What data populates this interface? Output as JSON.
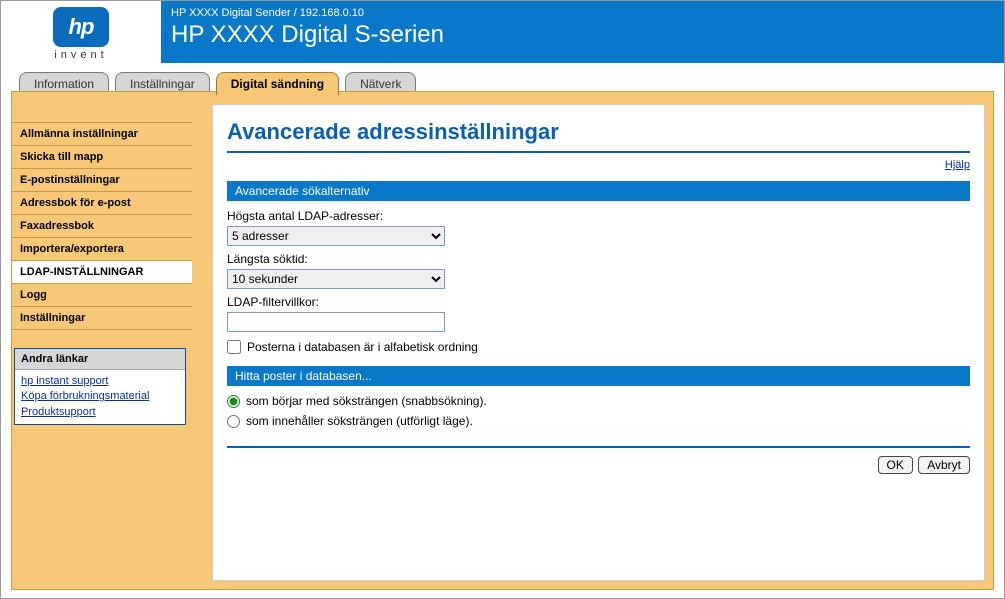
{
  "logo": {
    "brand": "hp",
    "tagline": "invent"
  },
  "header": {
    "breadcrumb": "HP XXXX Digital Sender / 192.168.0.10",
    "title": "HP XXXX Digital S-serien"
  },
  "tabs": [
    {
      "label": "Information"
    },
    {
      "label": "Inställningar"
    },
    {
      "label": "Digital sändning",
      "active": true
    },
    {
      "label": "Nätverk"
    }
  ],
  "sidebar": {
    "items": [
      {
        "label": "Allmänna inställningar"
      },
      {
        "label": "Skicka till mapp"
      },
      {
        "label": "E-postinställningar"
      },
      {
        "label": "Adressbok för e-post"
      },
      {
        "label": "Faxadressbok"
      },
      {
        "label": "Importera/exportera"
      },
      {
        "label": "LDAP-INSTÄLLNINGAR",
        "active": true
      },
      {
        "label": "Logg"
      },
      {
        "label": "Inställningar"
      }
    ]
  },
  "other_links": {
    "title": "Andra länkar",
    "items": [
      "hp instant support",
      "Köpa förbrukningsmaterial",
      "Produktsupport"
    ]
  },
  "main": {
    "heading": "Avancerade adressinställningar",
    "help": "Hjälp",
    "section1": {
      "title": "Avancerade sökalternativ",
      "max_ldap_label": "Högsta antal LDAP-adresser:",
      "max_ldap_value": "5 adresser",
      "longest_search_label": "Längsta söktid:",
      "longest_search_value": "10 sekunder",
      "filter_label": "LDAP-filtervillkor:",
      "filter_value": "",
      "alpha_checkbox": "Posterna i databasen är i alfabetisk ordning"
    },
    "section2": {
      "title": "Hitta poster i databasen...",
      "opt1": "som börjar med söksträngen (snabbsökning).",
      "opt2": "som innehåller söksträngen (utförligt läge)."
    },
    "buttons": {
      "ok": "OK",
      "cancel": "Avbryt"
    }
  }
}
